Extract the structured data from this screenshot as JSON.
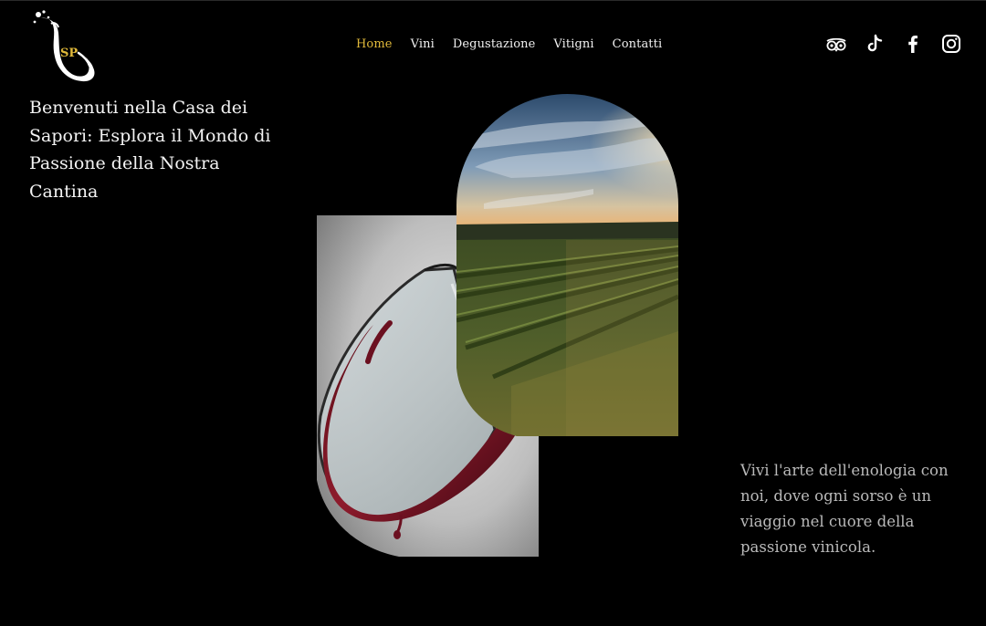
{
  "brand": {
    "logo_text": "SP",
    "logo_color": "#e0b93a"
  },
  "nav": {
    "items": [
      {
        "label": "Home",
        "active": true
      },
      {
        "label": "Vini",
        "active": false
      },
      {
        "label": "Degustazione",
        "active": false
      },
      {
        "label": "Vitigni",
        "active": false
      },
      {
        "label": "Contatti",
        "active": false
      }
    ],
    "active_color": "#e0b93a"
  },
  "social": {
    "icons": [
      "tripadvisor-icon",
      "tiktok-icon",
      "facebook-icon",
      "instagram-icon"
    ]
  },
  "hero": {
    "headline": "Benvenuti nella Casa dei Sapori: Esplora il Mondo di Passione della Nostra Cantina",
    "tagline": "Vivi l'arte dell'enologia con noi, dove ogni sorso è un viaggio nel cuore della passione vinicola."
  },
  "images": {
    "glass": "red-wine-glass-splash-image",
    "vineyard": "vineyard-sunset-image"
  }
}
